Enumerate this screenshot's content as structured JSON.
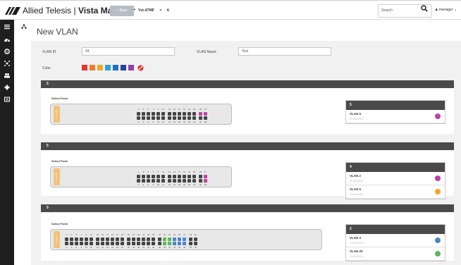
{
  "header": {
    "brand_name": "Allied Telesis",
    "product_name": "Vista Manager",
    "back_label": "< Back",
    "breadcrumb": [
      "Vst-ATMF",
      ">",
      "A"
    ],
    "search_placeholder": "Search",
    "user_label": "manager"
  },
  "sidebar": {
    "items": [
      "menu-icon",
      "dashboard-icon",
      "globe-icon",
      "network-icon",
      "users-icon",
      "gear-icon",
      "log-icon"
    ]
  },
  "page": {
    "title": "New VLAN"
  },
  "form": {
    "vlan_id_label": "VLAN ID",
    "vlan_id_value": "44",
    "vlan_name_label": "VLAN Name",
    "vlan_name_value": "Test",
    "color_label": "Color",
    "colors": [
      "#e8332f",
      "#f07a2a",
      "#f4a62a",
      "#2aa2d6",
      "#1a73c4",
      "#2c3e9e",
      "#8e44ad"
    ],
    "color_picker_icon": "no-color-icon"
  },
  "panels": [
    {
      "title": "5",
      "select_ports_label": "Select Ports",
      "tag": "AT-X510",
      "top_numbers": [
        "1",
        "3",
        "5",
        "7",
        "9",
        "11",
        "13",
        "15",
        "17",
        "19",
        "21",
        "23",
        "25",
        "27"
      ],
      "bottom_numbers": [
        "2",
        "4",
        "6",
        "8",
        "10",
        "12",
        "14",
        "16",
        "18",
        "20",
        "22",
        "24",
        "26",
        "28"
      ],
      "vlan_summary": {
        "count": "5",
        "vlans": [
          {
            "name": "VLAN 5",
            "sub": "VLAN0005",
            "color": "#c03fa0"
          }
        ]
      }
    },
    {
      "title": "5",
      "select_ports_label": "Select Ports",
      "tag": "AT-X510",
      "top_numbers": [
        "1",
        "3",
        "5",
        "7",
        "9",
        "11",
        "13",
        "15",
        "17",
        "19",
        "21",
        "23",
        "25",
        "27"
      ],
      "bottom_numbers": [
        "2",
        "4",
        "6",
        "8",
        "10",
        "12",
        "14",
        "16",
        "18",
        "20",
        "22",
        "24",
        "26",
        "28"
      ],
      "vlan_summary": {
        "count": "4",
        "vlans": [
          {
            "name": "VLAN 2",
            "sub": "VLAN0002",
            "color": "#c03fa0"
          },
          {
            "name": "VLAN 5",
            "sub": "VLAN0005",
            "color": "#f4a62a"
          }
        ]
      }
    },
    {
      "title": "5",
      "select_ports_label": "Select Ports",
      "tag": "AT-X510",
      "top_numbers": [
        "1",
        "3",
        "5",
        "7",
        "9",
        "11",
        "13",
        "15",
        "17",
        "19",
        "21",
        "23",
        "25",
        "27",
        "29",
        "31",
        "33",
        "35",
        "37",
        "39",
        "41",
        "43",
        "45",
        "47",
        "49",
        "51"
      ],
      "bottom_numbers": [
        "2",
        "4",
        "6",
        "8",
        "10",
        "12",
        "14",
        "16",
        "18",
        "20",
        "22",
        "24",
        "26",
        "28",
        "30",
        "32",
        "34",
        "36",
        "38",
        "40",
        "42",
        "44",
        "46",
        "48",
        "50",
        "52"
      ],
      "vlan_summary": {
        "count": "2",
        "vlans": [
          {
            "name": "VLAN 3",
            "sub": "VLAN0003",
            "color": "#4a86c8"
          },
          {
            "name": "VLAN 20",
            "sub": "VLAN0020",
            "color": "#5cb85c"
          }
        ]
      }
    }
  ]
}
